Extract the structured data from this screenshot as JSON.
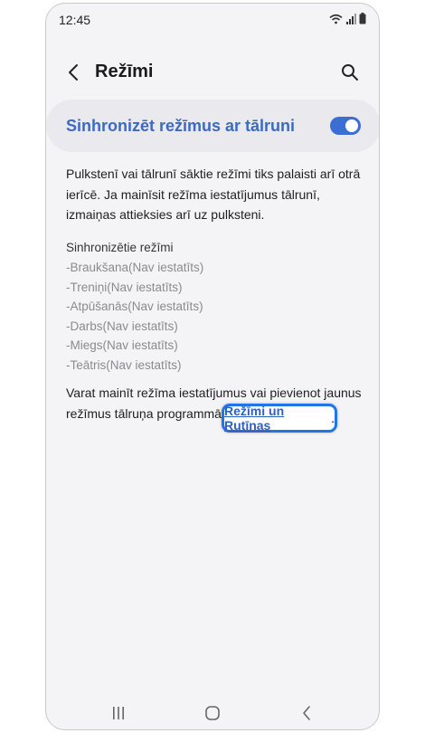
{
  "status_bar": {
    "time": "12:45"
  },
  "header": {
    "title": "Režīmi"
  },
  "sync": {
    "label": "Sinhronizēt režīmus ar tālruni",
    "enabled": true
  },
  "description": "Pulkstenī vai tālrunī sāktie režīmi tiks palaisti arī otrā ierīcē. Ja mainīsit režīma iestatījumus tālrunī, izmaiņas attieksies arī uz pulksteni.",
  "synced_modes": {
    "title": "Sinhronizētie režīmi",
    "items": [
      "-Braukšana(Nav iestatīts)",
      "-Treniņi(Nav iestatīts)",
      "-Atpūšanās(Nav iestatīts)",
      "-Darbs(Nav iestatīts)",
      "-Miegs(Nav iestatīts)",
      "-Teātris(Nav iestatīts)"
    ]
  },
  "footer": {
    "text": "Varat mainīt režīma iestatījumus vai pievienot jaunus režīmus tālruņa programmā",
    "link": "Režīmi un Rutīnas",
    "end": "."
  },
  "colors": {
    "accent": "#3a6ed3",
    "highlight": "#1f74ea"
  }
}
